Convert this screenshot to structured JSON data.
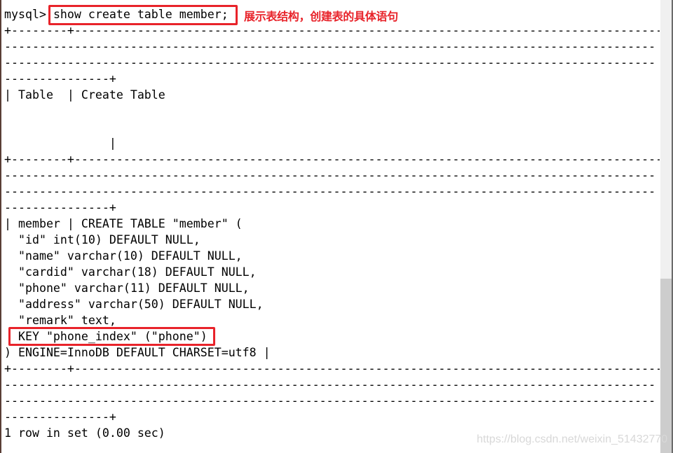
{
  "terminal": {
    "prompt": "mysql> ",
    "command": "show create table member;",
    "lines": [
      "+--------+----------------------------------------------------------------------------------------",
      "---------------------------------------------------------------------------------------------",
      "---------------------------------------------------------------------------------------------",
      "---------------+",
      "| Table  | Create Table",
      "",
      "",
      "               |",
      "+--------+----------------------------------------------------------------------------------------",
      "---------------------------------------------------------------------------------------------",
      "---------------------------------------------------------------------------------------------",
      "---------------+",
      "| member | CREATE TABLE \"member\" (",
      "  \"id\" int(10) DEFAULT NULL,",
      "  \"name\" varchar(10) DEFAULT NULL,",
      "  \"cardid\" varchar(18) DEFAULT NULL,",
      "  \"phone\" varchar(11) DEFAULT NULL,",
      "  \"address\" varchar(50) DEFAULT NULL,",
      "  \"remark\" text,",
      "  KEY \"phone_index\" (\"phone\")",
      ") ENGINE=InnoDB DEFAULT CHARSET=utf8 |",
      "+--------+----------------------------------------------------------------------------------------",
      "---------------------------------------------------------------------------------------------",
      "---------------------------------------------------------------------------------------------",
      "---------------+",
      "1 row in set (0.00 sec)"
    ]
  },
  "annotation": {
    "text": "展示表结构，创建表的具体语句",
    "color": "#e8232a"
  },
  "watermark": "https://blog.csdn.net/weixin_51432770"
}
